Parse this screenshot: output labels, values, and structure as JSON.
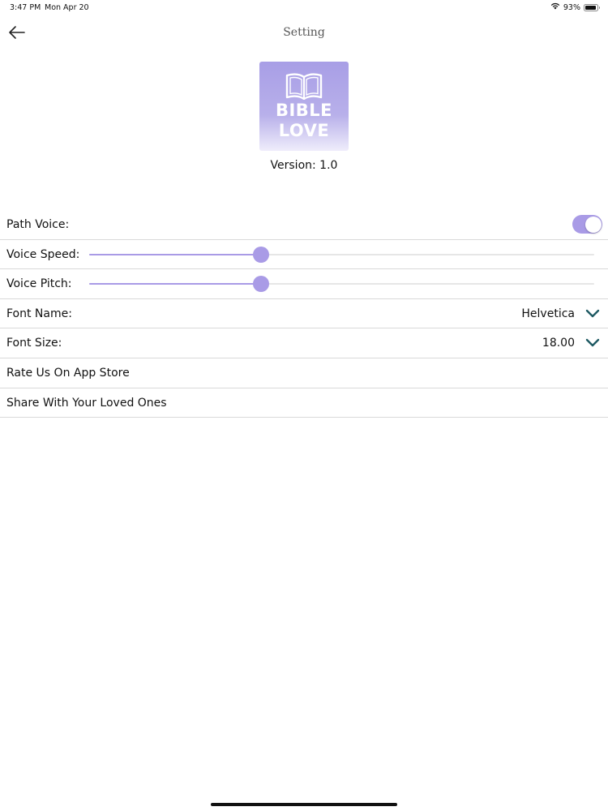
{
  "status_bar": {
    "time": "3:47 PM",
    "date": "Mon Apr 20",
    "battery": "93%",
    "battery_level": 0.93
  },
  "nav": {
    "title": "Setting",
    "back_icon": "arrow-left-icon"
  },
  "logo": {
    "line1": "BIBLE",
    "line2": "LOVE",
    "icon": "open-book-icon"
  },
  "version": "Version: 1.0",
  "settings": {
    "path_voice": {
      "label": "Path Voice:",
      "enabled": true
    },
    "voice_speed": {
      "label": "Voice Speed:",
      "value": 0.34
    },
    "voice_pitch": {
      "label": "Voice Pitch:",
      "value": 0.34
    },
    "font_name": {
      "label": "Font Name:",
      "value": "Helvetica"
    },
    "font_size": {
      "label": "Font Size:",
      "value": "18.00"
    },
    "rate_us": {
      "label": "Rate Us On App Store"
    },
    "share": {
      "label": "Share With Your Loved Ones"
    }
  },
  "colors": {
    "accent": "#a99be6",
    "chevron": "#1f5a63"
  }
}
